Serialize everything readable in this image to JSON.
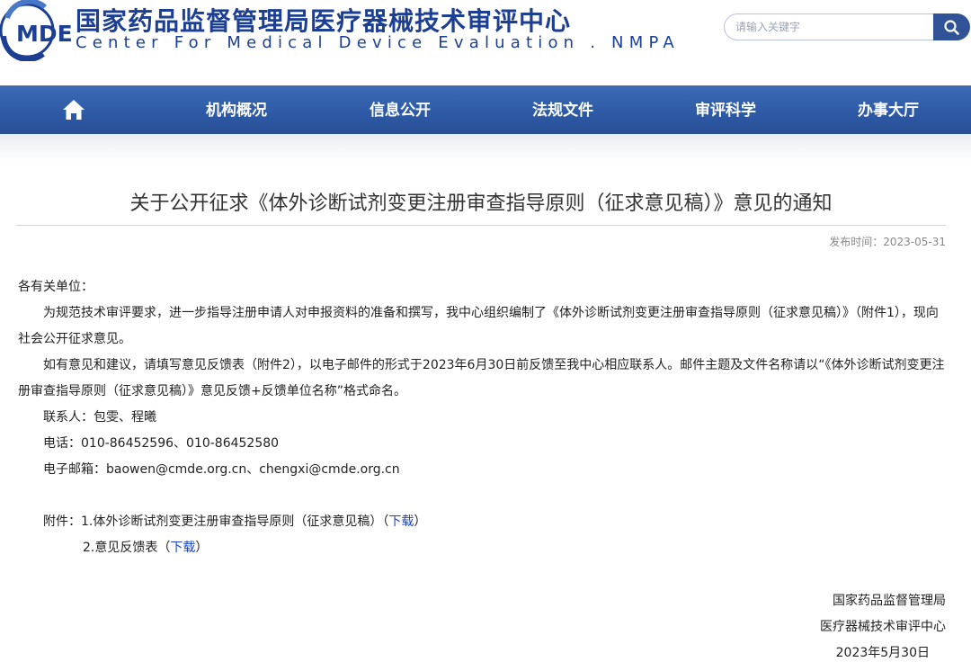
{
  "header": {
    "logo_text": "MDE",
    "cn_name": "国家药品监督管理局医疗器械技术审评中心",
    "en_name": "Center For Medical Device Evaluation . NMPA",
    "search_placeholder": "请输入关键字"
  },
  "nav": {
    "home_icon": "home-icon",
    "items": [
      "机构概况",
      "信息公开",
      "法规文件",
      "审评科学",
      "办事大厅"
    ]
  },
  "article": {
    "title": "关于公开征求《体外诊断试剂变更注册审查指导原则（征求意见稿）》意见的通知",
    "pub_label": "发布时间：",
    "pub_date": "2023-05-31",
    "salutation": "各有关单位：",
    "para1": "为规范技术审评要求，进一步指导注册申请人对申报资料的准备和撰写，我中心组织编制了《体外诊断试剂变更注册审查指导原则（征求意见稿）》（附件1），现向社会公开征求意见。",
    "para2": "如有意见和建议，请填写意见反馈表（附件2），以电子邮件的形式于2023年6月30日前反馈至我中心相应联系人。邮件主题及文件名称请以“《体外诊断试剂变更注册审查指导原则（征求意见稿）》意见反馈+反馈单位名称”格式命名。",
    "contact": "联系人：包雯、程曦",
    "phone": "电话：010-86452596、010-86452580",
    "email": "电子邮箱：baowen@cmde.org.cn、chengxi@cmde.org.cn",
    "attach_label": "附件：",
    "attach1": "1.体外诊断试剂变更注册审查指导原则（征求意见稿）（",
    "attach2": "2.意见反馈表（",
    "download": "下载",
    "close_paren": "）",
    "sign_org1": "国家药品监督管理局",
    "sign_org2": "医疗器械技术审评中心",
    "sign_date": "2023年5月30日"
  },
  "colors": {
    "brand_blue": "#1d3f93",
    "nav_blue": "#2e5aa6",
    "link_blue": "#1a43c7"
  }
}
